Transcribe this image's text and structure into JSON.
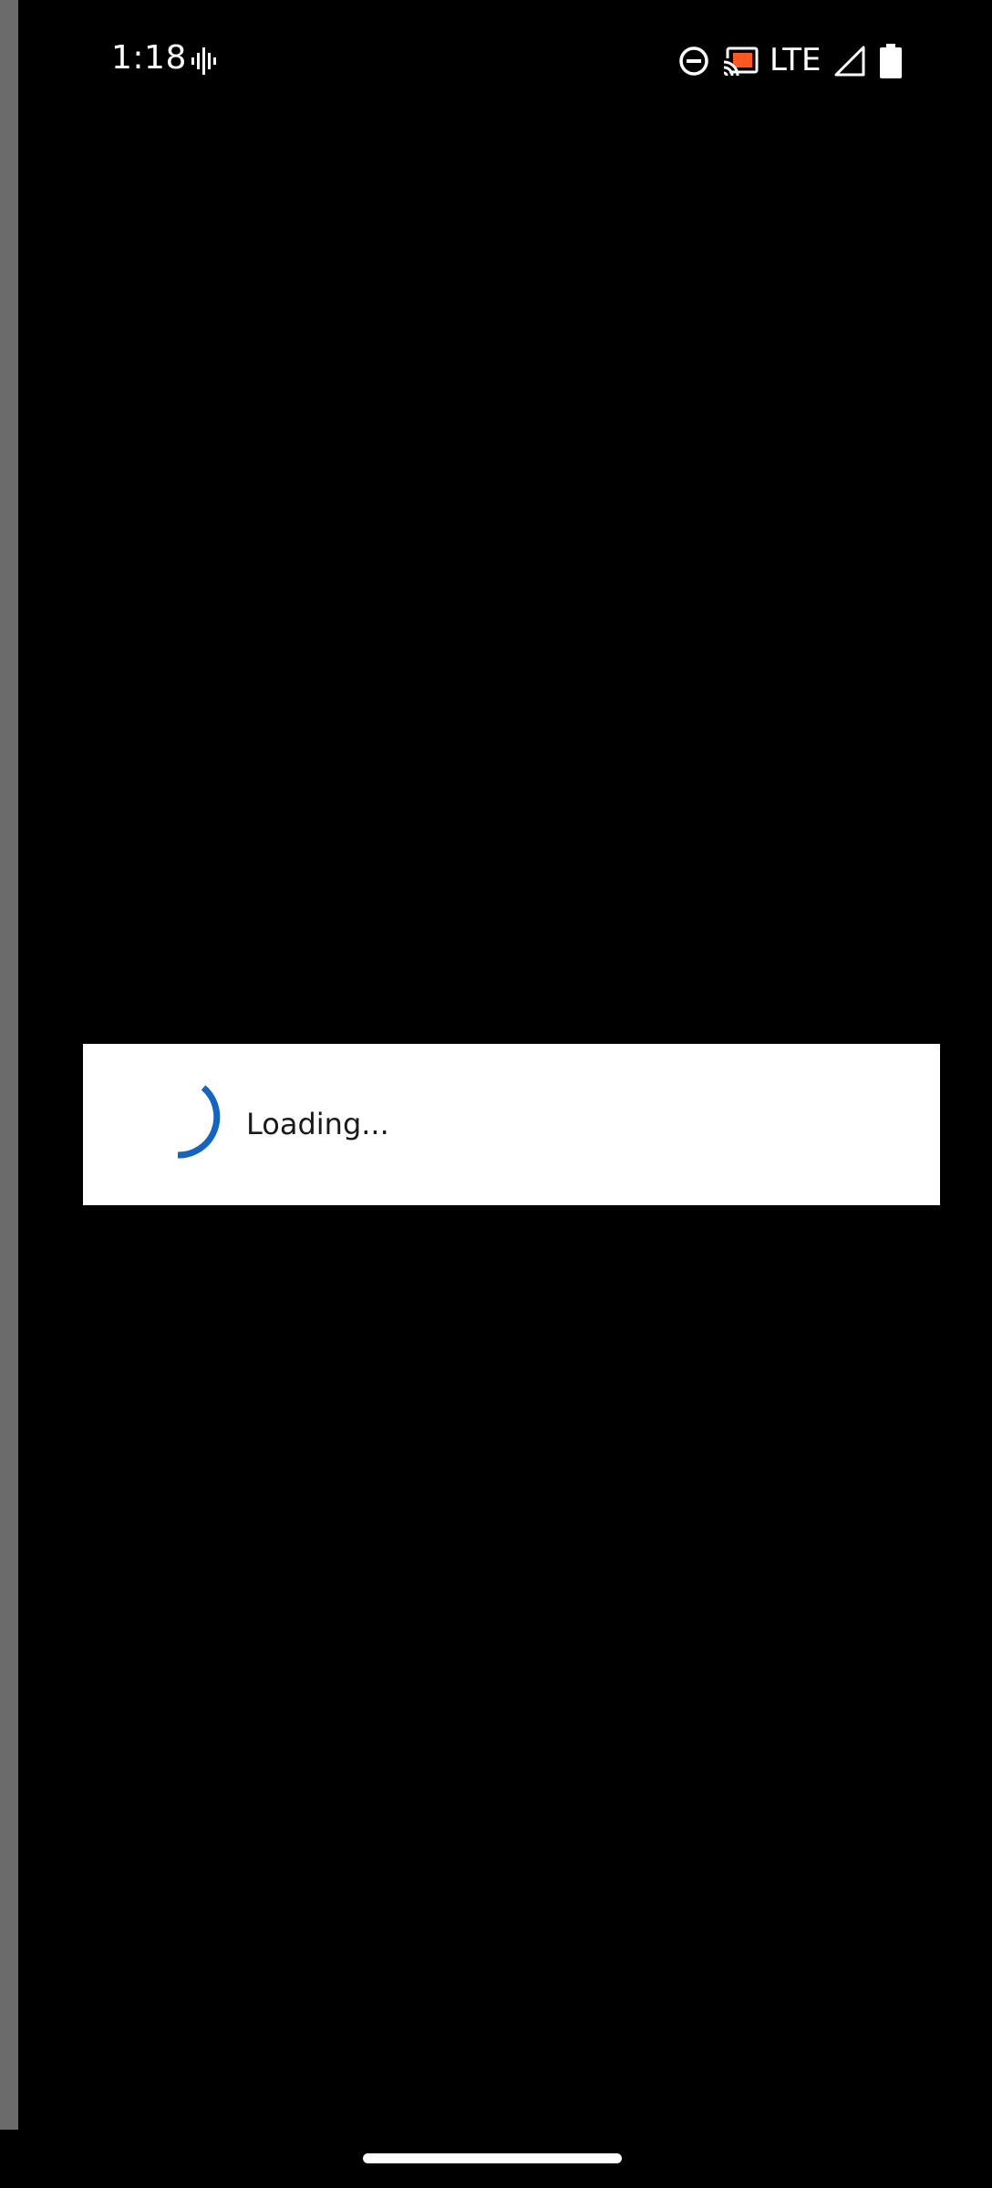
{
  "status_bar": {
    "time": "1:18",
    "network": "LTE",
    "icons": {
      "voice": "voice-waveform-icon",
      "dnd": "do-not-disturb-icon",
      "cast": "cast-icon",
      "signal": "signal-icon",
      "battery": "battery-icon"
    },
    "cast_color": "#ff5722"
  },
  "dialog": {
    "message": "Loading...",
    "spinner_color": "#1565c0"
  },
  "colors": {
    "background": "#000000",
    "side_strip": "#6b6b6b",
    "dialog_background": "#ffffff"
  }
}
